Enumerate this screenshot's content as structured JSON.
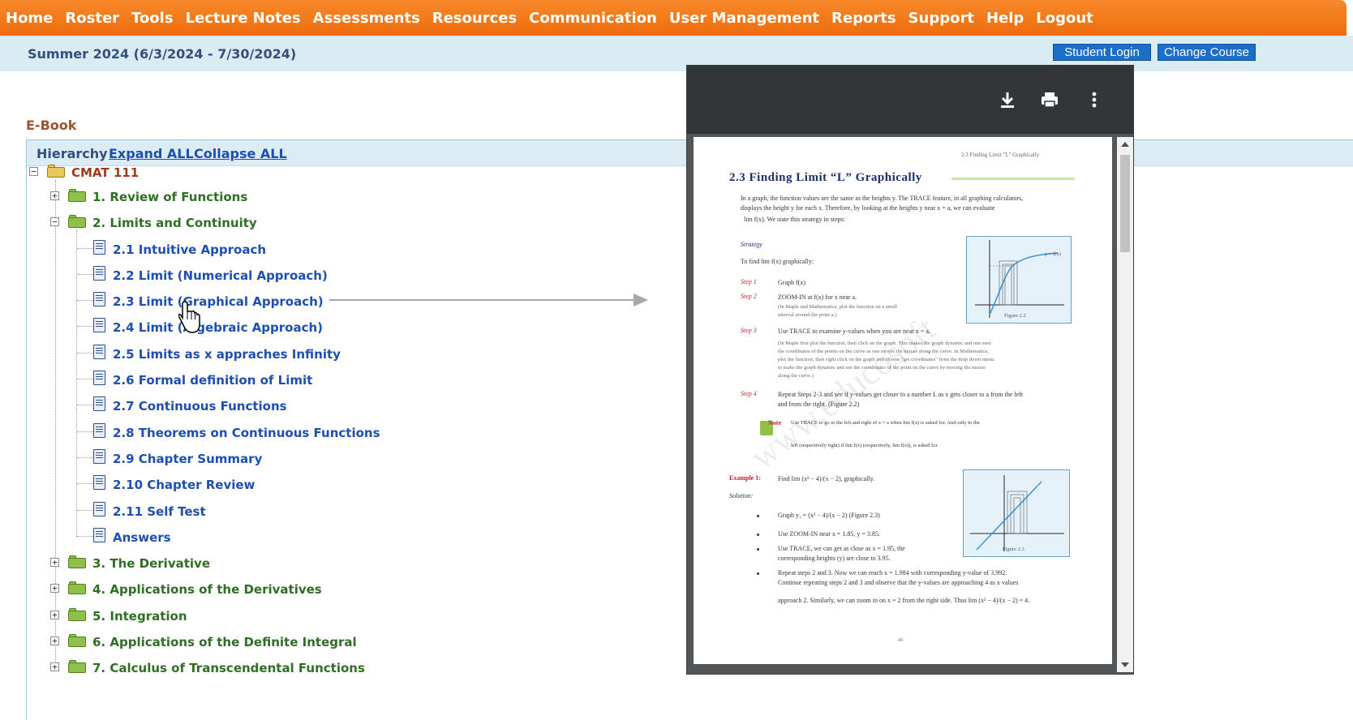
{
  "nav": {
    "items": [
      "Home",
      "Roster",
      "Tools",
      "Lecture Notes",
      "Assessments",
      "Resources",
      "Communication",
      "User Management",
      "Reports",
      "Support",
      "Help",
      "Logout"
    ]
  },
  "session": {
    "label": "Summer 2024 (6/3/2024 - 7/30/2024)",
    "student_login": "Student Login",
    "change_course": "Change Course"
  },
  "ebook": {
    "title": "E-Book",
    "hierarchy": "Hierarchy",
    "expand_all": "Expand ALL",
    "collapse_all": "Collapse ALL"
  },
  "tree": {
    "root": "CMAT 111",
    "chapters": [
      "1. Review of Functions",
      "2. Limits and Continuity",
      "3. The Derivative",
      "4. Applications of the Derivatives",
      "5. Integration",
      "6. Applications of the Definite Integral",
      "7. Calculus of Transcendental Functions"
    ],
    "sections": [
      "2.1 Intuitive Approach",
      "2.2 Limit (Numerical Approach)",
      "2.3 Limit (Graphical Approach)",
      "2.4 Limit (Algebraic Approach)",
      "2.5 Limits as x appraches Infinity",
      "2.6 Formal definition of Limit",
      "2.7 Continuous Functions",
      "2.8 Theorems on Continuous Functions",
      "2.9 Chapter Summary",
      "2.10 Chapter Review",
      "2.11 Self Test",
      "Answers"
    ]
  },
  "pdf": {
    "running_head": "2.3  Finding Limit \"L\" Graphically",
    "section_title": "2.3   Finding Limit “L” Graphically",
    "intro_1": "In a graph, the function values are the same as the heights y. The TRACE feature, in all graphing calculators,",
    "intro_2": "displays the height y for each x.  Therefore, by looking at the heights y near x = a, we can evaluate",
    "intro_3": "lim  f(x). We state this strategy in steps:",
    "strategy": "Strategy",
    "to_find": "To find   lim   f(x) graphically:",
    "steps": [
      {
        "label": "Step 1",
        "text": "Graph f(x)"
      },
      {
        "label": "Step 2",
        "text": "ZOOM-IN at f(x) for x near a."
      },
      {
        "label": "Step 3",
        "text": "Use TRACE to examine y-values when you are near x = a."
      },
      {
        "label": "Step 4",
        "text": "Repeat Steps 2-3 and see if y-values get closer to a number L as x gets closer to a from the left"
      }
    ],
    "step2_note_1": "(In Maple and Mathematica, plot the function on a small",
    "step2_note_2": "interval around the point a.)",
    "step3_note_1": "(In Maple first plot the function, then click on the graph. This makes the graph dynamic and one sees",
    "step3_note_2": "the coordinates of the points on the curve as one moves the mouse along the curve.  In Mathematica,",
    "step3_note_3": "plot the function, then right click on the graph and choose \"get coordinates\" from the drop down menu",
    "step3_note_4": "to make the graph dynamic and see the coordinates of the point on the curve by moving the mouse",
    "step3_note_5": "along the curve.)",
    "step4_cont": "and from the right. (Figure 2.2)",
    "note_label": "Note",
    "note_1": "Use TRACE to go to the left and right of x = a when   lim   f(x) is asked for.  And only to the",
    "note_2": "left (respectively right) if   lim   f(x) (respectively,   lim   f(x)), is asked for.",
    "example_label": "Example 1:",
    "example_text": "Find   lim  (x² − 4)/(x − 2), graphically.",
    "solution": "Solution:",
    "bullets": [
      "Graph y₁ = (x² − 4)/(x − 2)  (Figure 2.3)",
      "Use ZOOM-IN near x = 1.85, y = 3.85.",
      "Use TRACE, we can get as close as x = 1.95, the",
      "Repeat steps 2 and 3.  Now we can reach x = 1.984 with corresponding y-value of 3.992."
    ],
    "bullet3_cont": "corresponding heights (y) are close to 3.95.",
    "bullet4_cont": "Continue repeating steps 2 and 3 and observe that the y-values are approaching 4 as x values",
    "bullet4_cont2": "approach 2.  Similarly, we can zoom in on x = 2 from the right side.  Thus   lim  (x² − 4)/(x − 2) = 4.",
    "figure_22": "Figure 2.2",
    "figure_23": "Figure 2.3",
    "curve_label": "y = f(x)",
    "page_number": "45",
    "watermark": "www.educosoft"
  }
}
